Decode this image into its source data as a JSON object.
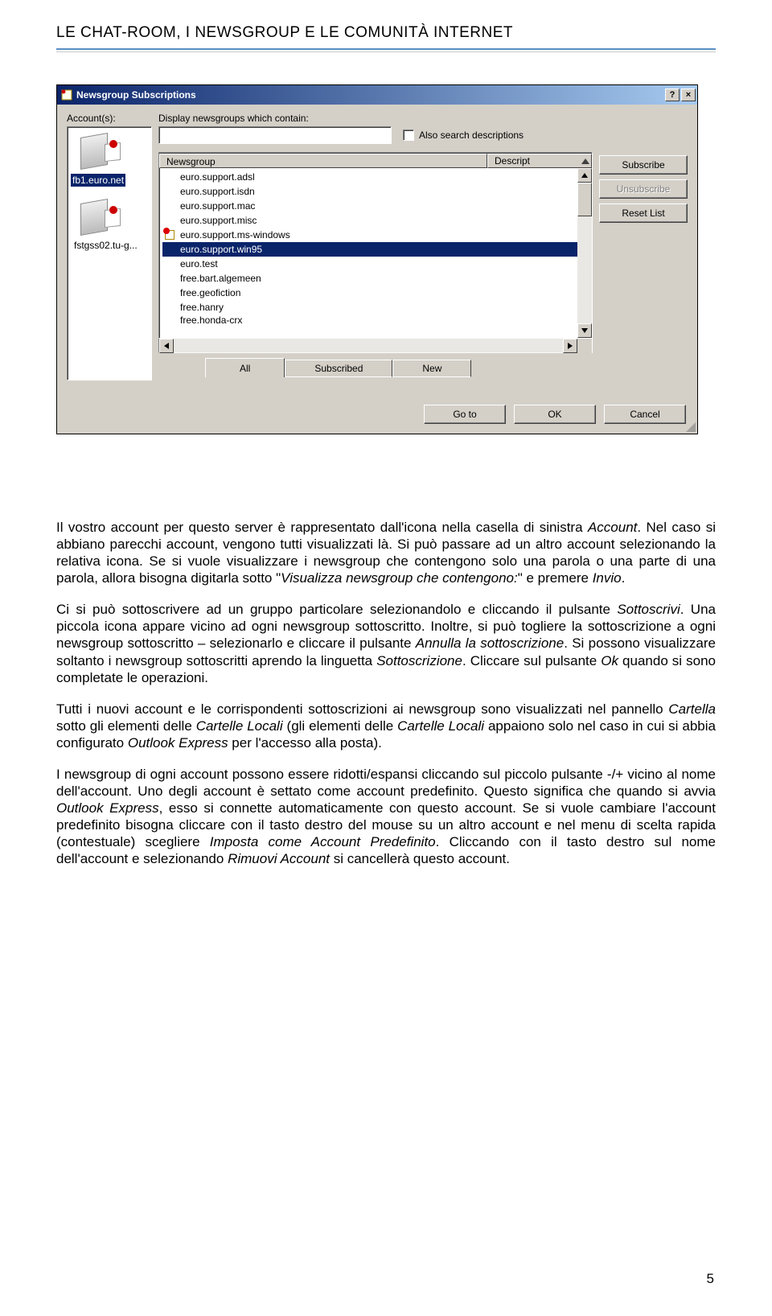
{
  "header": {
    "title": "LE CHAT-ROOM, I NEWSGROUP E LE COMUNITÀ INTERNET"
  },
  "dialog": {
    "title": "Newsgroup Subscriptions",
    "labels": {
      "accounts": "Account(s):",
      "filter": "Display newsgroups which contain:",
      "also_search": "Also search descriptions"
    },
    "columns": {
      "newsgroup": "Newsgroup",
      "description": "Descript"
    },
    "accounts": [
      {
        "name": "fb1.euro.net",
        "selected": true
      },
      {
        "name": "fstgss02.tu-g...",
        "selected": false
      }
    ],
    "newsgroups": [
      {
        "name": "euro.support.adsl",
        "subscribed": false,
        "selected": false
      },
      {
        "name": "euro.support.isdn",
        "subscribed": false,
        "selected": false
      },
      {
        "name": "euro.support.mac",
        "subscribed": false,
        "selected": false
      },
      {
        "name": "euro.support.misc",
        "subscribed": false,
        "selected": false
      },
      {
        "name": "euro.support.ms-windows",
        "subscribed": true,
        "selected": false
      },
      {
        "name": "euro.support.win95",
        "subscribed": false,
        "selected": true
      },
      {
        "name": "euro.test",
        "subscribed": false,
        "selected": false
      },
      {
        "name": "free.bart.algemeen",
        "subscribed": false,
        "selected": false
      },
      {
        "name": "free.geofiction",
        "subscribed": false,
        "selected": false
      },
      {
        "name": "free.hanry",
        "subscribed": false,
        "selected": false
      },
      {
        "name": "free.honda-crx",
        "subscribed": false,
        "selected": false,
        "clipped": true
      }
    ],
    "tabs": [
      {
        "label": "All",
        "active": true
      },
      {
        "label": "Subscribed",
        "active": false
      },
      {
        "label": "New",
        "active": false
      }
    ],
    "buttons": {
      "subscribe": "Subscribe",
      "unsubscribe": "Unsubscribe",
      "reset": "Reset List",
      "goto": "Go to",
      "ok": "OK",
      "cancel": "Cancel"
    },
    "titlebar_buttons": {
      "help": "?",
      "close": "×"
    }
  },
  "paragraphs": {
    "p1a": "Il vostro account per questo server è rappresentato dall'icona nella casella di sinistra ",
    "p1a_i": "Account",
    "p1b": ". Nel caso si abbiano parecchi account, vengono tutti visualizzati là. Si può passare ad un altro account selezionando la relativa icona. Se si vuole visualizzare i newsgroup che contengono solo una parola o una parte di una parola, allora bisogna digitarla sotto \"",
    "p1b_i": "Visualizza newsgroup che contengono:",
    "p1c": "\" e premere ",
    "p1c_i": "Invio",
    "p1d": ".",
    "p2a": "Ci si può sottoscrivere ad un gruppo particolare selezionandolo e cliccando il pulsante ",
    "p2a_i": "Sottoscrivi",
    "p2b": ". Una piccola icona appare vicino ad ogni newsgroup sottoscritto. Inoltre, si può togliere la sottoscrizione a ogni newsgroup sottoscritto – selezionarlo e cliccare il pulsante ",
    "p2b_i": "Annulla la sottoscrizione",
    "p2c": ".  Si possono visualizzare soltanto i newsgroup sottoscritti aprendo la linguetta ",
    "p2c_i": "Sottoscrizione",
    "p2d": ". Cliccare sul pulsante ",
    "p2d_i": "Ok",
    "p2e": " quando si sono completate le operazioni.",
    "p3a": "Tutti i nuovi account e le corrispondenti sottoscrizioni ai newsgroup sono visualizzati nel pannello ",
    "p3a_i": "Cartella",
    "p3b": " sotto gli elementi delle ",
    "p3b_i": "Cartelle Locali",
    "p3c": " (gli elementi delle ",
    "p3c_i": "Cartelle Locali",
    "p3d": " appaiono solo nel caso in cui si abbia configurato ",
    "p3d_i": "Outlook Express",
    "p3e": " per l'accesso alla posta).",
    "p4a": "I newsgroup di ogni account possono essere ridotti/espansi cliccando sul piccolo pulsante -/+ vicino al nome dell'account. Uno degli account è settato come account predefinito. Questo significa che quando si avvia ",
    "p4a_i": "Outlook Express",
    "p4b": ", esso si connette automaticamente con questo account. Se si vuole cambiare l'account predefinito bisogna cliccare con il tasto destro del mouse su un altro account e nel menu di scelta rapida (contestuale) scegliere ",
    "p4b_i": "Imposta come Account Predefinito",
    "p4c": ". Cliccando con il tasto destro sul nome dell'account e selezionando ",
    "p4c_i": "Rimuovi Account",
    "p4d": " si cancellerà questo account."
  },
  "page_number": "5"
}
